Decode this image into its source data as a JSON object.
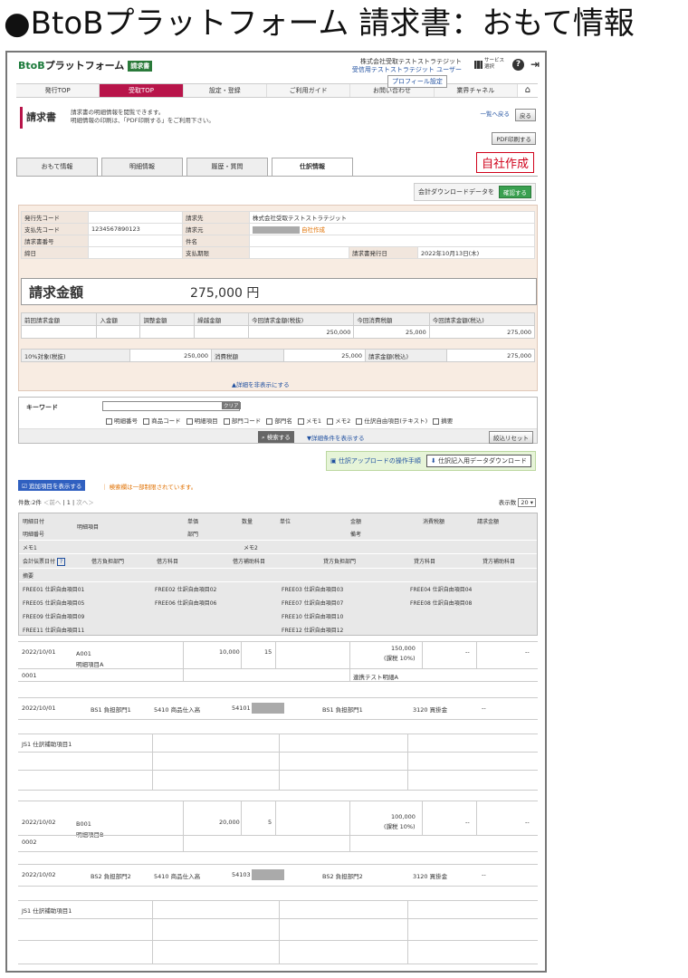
{
  "page_heading": "●BtoBプラットフォーム 請求書：おもて情報",
  "header": {
    "logo_prefix": "BtoB",
    "logo_suffix": "プラットフォーム",
    "logo_badge": "請求書",
    "company_line1": "株式会社受取テストストラテジット",
    "company_line2": "受信用テストストラテジット",
    "user_label": "ユーザー",
    "service_label": "サービス選択",
    "profile_tooltip": "プロフィール設定"
  },
  "nav": {
    "items": [
      "発行TOP",
      "受取TOP",
      "設定・登録",
      "ご利用ガイド",
      "お問い合わせ",
      "業界チャネル"
    ]
  },
  "page": {
    "title": "請求書",
    "desc1": "請求書の明細情報を閲覧できます。",
    "desc2": "明細情報の印刷は、「PDF印刷する」をご利用下さい。",
    "link_list": "一覧へ戻る",
    "link_back": "戻る",
    "pdf_button": "PDF印刷する"
  },
  "tabs": [
    "おもて情報",
    "明細情報",
    "履歴・質問",
    "仕訳情報"
  ],
  "self_made": "自社作成",
  "download1": {
    "label": "会計ダウンロードデータを",
    "button": "確認する"
  },
  "info": {
    "labels": [
      "発行先コード",
      "請求先",
      "支払先コード",
      "請求元",
      "請求書番号",
      "件名",
      "締日",
      "支払期限",
      "請求書発行日"
    ],
    "billing_to": "株式会社受取テストストラテジット",
    "payee_code": "1234567890123",
    "self_badge": "自社作成",
    "issue_date": "2022年10月13日(木)"
  },
  "amount": {
    "label": "請求金額",
    "value": "275,000 円"
  },
  "summary": {
    "headers": [
      "前回請求金額",
      "入金額",
      "調整金額",
      "繰越金額",
      "今回請求金額(税抜)",
      "今回消費税額",
      "今回請求金額(税込)"
    ],
    "values": [
      "",
      "",
      "",
      "",
      "250,000",
      "25,000",
      "275,000"
    ],
    "row2_labels": [
      "10%対象(税抜)",
      "消費税額",
      "請求金額(税込)"
    ],
    "row2_values": [
      "250,000",
      "25,000",
      "275,000"
    ]
  },
  "toggle_detail": "▲詳細を非表示にする",
  "keyword": {
    "label": "キーワード",
    "clear": "クリア",
    "checks": [
      "明細番号",
      "商品コード",
      "明細項目",
      "部門コード",
      "部門名",
      "メモ1",
      "メモ2",
      "仕訳自由項目(テキスト)",
      "摘要"
    ],
    "search": "検索する",
    "advanced": "▼詳細条件を表示する",
    "reset": "絞込リセット"
  },
  "download2": {
    "manual": "仕訳アップロードの操作手順",
    "button": "仕訳記入用データダウンロード"
  },
  "list": {
    "show_additional": "追加項目を表示する",
    "notice": "｜ 検索欄は一部制限されています。",
    "count_label": "件数:2件",
    "prev": "＜前へ",
    "page": "1",
    "next": "次へ＞",
    "display_label": "表示数",
    "display_value": "20"
  },
  "grid_header": {
    "r1": [
      "明細日付",
      "単価",
      "数量",
      "単位",
      "金額",
      "消費税額",
      "請求金額"
    ],
    "item": "明細項目",
    "r2": [
      "明細番号",
      "部門",
      "備考"
    ],
    "r3": [
      "メモ1",
      "メモ2"
    ],
    "r4": [
      "会計伝票日付",
      "借方負担部門",
      "借方科目",
      "借方補助科目",
      "貸方負担部門",
      "貸方科目",
      "貸方補助科目"
    ],
    "r5": "摘要",
    "free": [
      "FREE01 仕訳自由項目01",
      "FREE02 仕訳自由項目02",
      "FREE03 仕訳自由項目03",
      "FREE04 仕訳自由項目04",
      "FREE05 仕訳自由項目05",
      "FREE06 仕訳自由項目06",
      "FREE07 仕訳自由項目07",
      "FREE08 仕訳自由項目08",
      "FREE09 仕訳自由項目09",
      "FREE10 仕訳自由項目10",
      "FREE11 仕訳自由項目11",
      "FREE12 仕訳自由項目12"
    ]
  },
  "rows": [
    {
      "date": "2022/10/01",
      "code": "A001",
      "item": "明細項目A",
      "unit_price": "10,000",
      "qty": "15",
      "amount": "150,000",
      "tax_note": "(課税 10%)",
      "tax": "--",
      "total": "--",
      "number": "0001",
      "remark": "連携テスト明細A",
      "acct_date": "2022/10/01",
      "debit_dept": "BS1 負担部門1",
      "debit_acct": "5410 商品仕入高",
      "debit_sub": "54101",
      "credit_dept": "BS1 負担部門1",
      "credit_acct": "3120 買掛金",
      "credit_sub": "--",
      "summary": "JS1 仕訳補助項目1"
    },
    {
      "date": "2022/10/02",
      "code": "B001",
      "item": "明細項目B",
      "unit_price": "20,000",
      "qty": "5",
      "amount": "100,000",
      "tax_note": "(課税 10%)",
      "tax": "--",
      "total": "--",
      "number": "0002",
      "remark": "",
      "acct_date": "2022/10/02",
      "debit_dept": "BS2 負担部門2",
      "debit_acct": "5410 商品仕入高",
      "debit_sub": "54103",
      "credit_dept": "BS2 負担部門2",
      "credit_acct": "3120 買掛金",
      "credit_sub": "--",
      "summary": "JS1 仕訳補助項目1"
    }
  ]
}
